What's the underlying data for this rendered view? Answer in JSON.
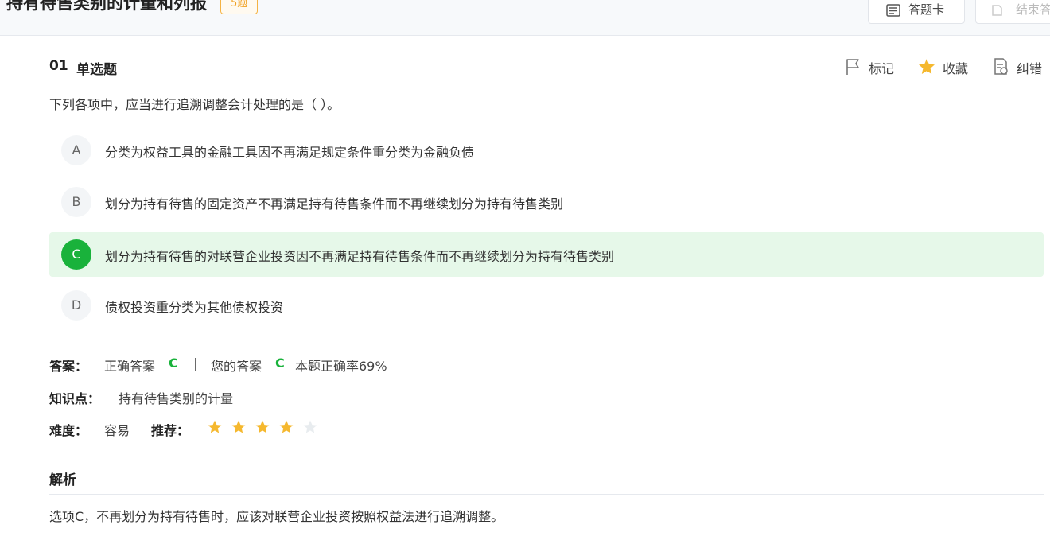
{
  "header": {
    "title": "持有待售类别的计量和列报",
    "count_badge": "5题",
    "card_button": "答题卡",
    "end_button": "结束答"
  },
  "question": {
    "number": "01",
    "type": "单选题",
    "stem": "下列各项中，应当进行追溯调整会计处理的是（ ）。",
    "tools": {
      "mark": "标记",
      "favorite": "收藏",
      "error": "纠错"
    },
    "options": [
      {
        "letter": "A",
        "text": "分类为权益工具的金融工具因不再满足规定条件重分类为金融负债",
        "selected": false
      },
      {
        "letter": "B",
        "text": "划分为持有待售的固定资产不再满足持有待售条件而不再继续划分为持有待售类别",
        "selected": false
      },
      {
        "letter": "C",
        "text": "划分为持有待售的对联营企业投资因不再满足持有待售条件而不再继续划分为持有待售类别",
        "selected": true
      },
      {
        "letter": "D",
        "text": "债权投资重分类为其他债权投资",
        "selected": false
      }
    ]
  },
  "answer": {
    "label": "答案：",
    "correct_label": "正确答案",
    "correct_value": "C",
    "separator": "|",
    "your_label": "您的答案",
    "your_value": "C",
    "accuracy": "本题正确率69%"
  },
  "knowledge": {
    "label": "知识点：",
    "value": "持有待售类别的计量"
  },
  "difficulty": {
    "label": "难度：",
    "value": "容易",
    "recommend_label": "推荐：",
    "recommend_stars": 4,
    "max_stars": 5
  },
  "analysis": {
    "title": "解析",
    "text": "选项C，不再划分为持有待售时，应该对联营企业投资按照权益法进行追溯调整。"
  },
  "colors": {
    "correct_green": "#19b23b",
    "selected_bg": "#e6f8e9",
    "star_gold": "#f5b82e",
    "star_empty": "#e8ecef",
    "badge_orange": "#f0a020"
  }
}
